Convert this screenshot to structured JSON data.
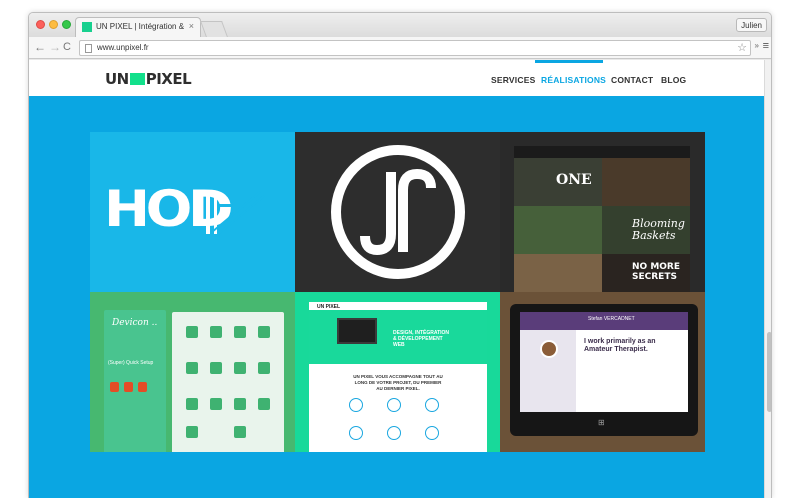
{
  "browser": {
    "tab_title": "UN PIXEL | Intégration & D",
    "tab_close": "×",
    "profile": "Julien",
    "url": "www.unpixel.fr",
    "back": "←",
    "forward": "→",
    "reload": "C",
    "star": "☆",
    "ext": "»",
    "menu": "≡"
  },
  "site": {
    "logo_left": "UN",
    "logo_right": "PIXEL",
    "nav": [
      {
        "label": "SERVICES",
        "active": false
      },
      {
        "label": "RÉALISATIONS",
        "active": true
      },
      {
        "label": "CONTACT",
        "active": false
      },
      {
        "label": "BLOG",
        "active": false
      }
    ]
  },
  "portfolio": {
    "tile1": {
      "text": "HOD"
    },
    "tile3": {
      "one": "ONE",
      "blooming": "Blooming Baskets",
      "secrets": "NO MORE SECRETS"
    },
    "tile4": {
      "title": "Devicon ..",
      "sub": "(Super) Quick Setup"
    },
    "tile5": {
      "logo": "UN PIXEL",
      "head": "DESIGN, INTÉGRATION & DÉVELOPPEMENT WEB",
      "tag": "UN PIXEL VOUS ACCOMPAGNE TOUT AU LONG DE VOTRE PROJET, DU PREMIER AU DERNIER PIXEL."
    },
    "tile6": {
      "headline": "I work primarily as an Amateur Therapist.",
      "sub": "Stefan VERCADNET"
    }
  },
  "colors": {
    "accent": "#0aa6e2",
    "brand_green": "#12e08b"
  }
}
